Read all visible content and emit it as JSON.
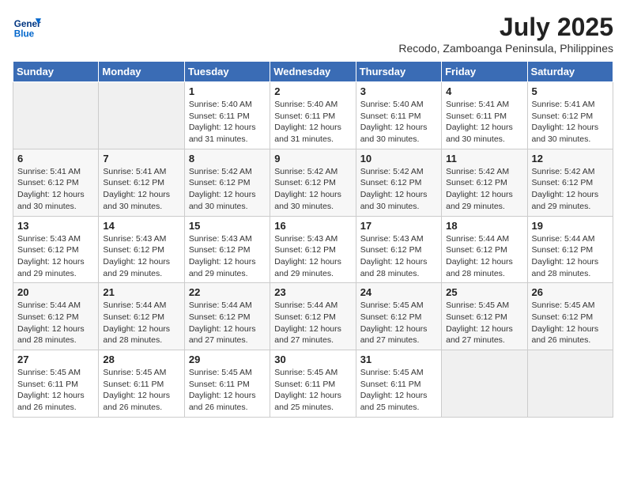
{
  "header": {
    "logo_line1": "General",
    "logo_line2": "Blue",
    "month_year": "July 2025",
    "location": "Recodo, Zamboanga Peninsula, Philippines"
  },
  "days_of_week": [
    "Sunday",
    "Monday",
    "Tuesday",
    "Wednesday",
    "Thursday",
    "Friday",
    "Saturday"
  ],
  "weeks": [
    [
      {
        "day": "",
        "empty": true
      },
      {
        "day": "",
        "empty": true
      },
      {
        "day": "1",
        "sunrise": "5:40 AM",
        "sunset": "6:11 PM",
        "daylight": "12 hours and 31 minutes."
      },
      {
        "day": "2",
        "sunrise": "5:40 AM",
        "sunset": "6:11 PM",
        "daylight": "12 hours and 31 minutes."
      },
      {
        "day": "3",
        "sunrise": "5:40 AM",
        "sunset": "6:11 PM",
        "daylight": "12 hours and 30 minutes."
      },
      {
        "day": "4",
        "sunrise": "5:41 AM",
        "sunset": "6:11 PM",
        "daylight": "12 hours and 30 minutes."
      },
      {
        "day": "5",
        "sunrise": "5:41 AM",
        "sunset": "6:12 PM",
        "daylight": "12 hours and 30 minutes."
      }
    ],
    [
      {
        "day": "6",
        "sunrise": "5:41 AM",
        "sunset": "6:12 PM",
        "daylight": "12 hours and 30 minutes."
      },
      {
        "day": "7",
        "sunrise": "5:41 AM",
        "sunset": "6:12 PM",
        "daylight": "12 hours and 30 minutes."
      },
      {
        "day": "8",
        "sunrise": "5:42 AM",
        "sunset": "6:12 PM",
        "daylight": "12 hours and 30 minutes."
      },
      {
        "day": "9",
        "sunrise": "5:42 AM",
        "sunset": "6:12 PM",
        "daylight": "12 hours and 30 minutes."
      },
      {
        "day": "10",
        "sunrise": "5:42 AM",
        "sunset": "6:12 PM",
        "daylight": "12 hours and 30 minutes."
      },
      {
        "day": "11",
        "sunrise": "5:42 AM",
        "sunset": "6:12 PM",
        "daylight": "12 hours and 29 minutes."
      },
      {
        "day": "12",
        "sunrise": "5:42 AM",
        "sunset": "6:12 PM",
        "daylight": "12 hours and 29 minutes."
      }
    ],
    [
      {
        "day": "13",
        "sunrise": "5:43 AM",
        "sunset": "6:12 PM",
        "daylight": "12 hours and 29 minutes."
      },
      {
        "day": "14",
        "sunrise": "5:43 AM",
        "sunset": "6:12 PM",
        "daylight": "12 hours and 29 minutes."
      },
      {
        "day": "15",
        "sunrise": "5:43 AM",
        "sunset": "6:12 PM",
        "daylight": "12 hours and 29 minutes."
      },
      {
        "day": "16",
        "sunrise": "5:43 AM",
        "sunset": "6:12 PM",
        "daylight": "12 hours and 29 minutes."
      },
      {
        "day": "17",
        "sunrise": "5:43 AM",
        "sunset": "6:12 PM",
        "daylight": "12 hours and 28 minutes."
      },
      {
        "day": "18",
        "sunrise": "5:44 AM",
        "sunset": "6:12 PM",
        "daylight": "12 hours and 28 minutes."
      },
      {
        "day": "19",
        "sunrise": "5:44 AM",
        "sunset": "6:12 PM",
        "daylight": "12 hours and 28 minutes."
      }
    ],
    [
      {
        "day": "20",
        "sunrise": "5:44 AM",
        "sunset": "6:12 PM",
        "daylight": "12 hours and 28 minutes."
      },
      {
        "day": "21",
        "sunrise": "5:44 AM",
        "sunset": "6:12 PM",
        "daylight": "12 hours and 28 minutes."
      },
      {
        "day": "22",
        "sunrise": "5:44 AM",
        "sunset": "6:12 PM",
        "daylight": "12 hours and 27 minutes."
      },
      {
        "day": "23",
        "sunrise": "5:44 AM",
        "sunset": "6:12 PM",
        "daylight": "12 hours and 27 minutes."
      },
      {
        "day": "24",
        "sunrise": "5:45 AM",
        "sunset": "6:12 PM",
        "daylight": "12 hours and 27 minutes."
      },
      {
        "day": "25",
        "sunrise": "5:45 AM",
        "sunset": "6:12 PM",
        "daylight": "12 hours and 27 minutes."
      },
      {
        "day": "26",
        "sunrise": "5:45 AM",
        "sunset": "6:12 PM",
        "daylight": "12 hours and 26 minutes."
      }
    ],
    [
      {
        "day": "27",
        "sunrise": "5:45 AM",
        "sunset": "6:11 PM",
        "daylight": "12 hours and 26 minutes."
      },
      {
        "day": "28",
        "sunrise": "5:45 AM",
        "sunset": "6:11 PM",
        "daylight": "12 hours and 26 minutes."
      },
      {
        "day": "29",
        "sunrise": "5:45 AM",
        "sunset": "6:11 PM",
        "daylight": "12 hours and 26 minutes."
      },
      {
        "day": "30",
        "sunrise": "5:45 AM",
        "sunset": "6:11 PM",
        "daylight": "12 hours and 25 minutes."
      },
      {
        "day": "31",
        "sunrise": "5:45 AM",
        "sunset": "6:11 PM",
        "daylight": "12 hours and 25 minutes."
      },
      {
        "day": "",
        "empty": true
      },
      {
        "day": "",
        "empty": true
      }
    ]
  ]
}
